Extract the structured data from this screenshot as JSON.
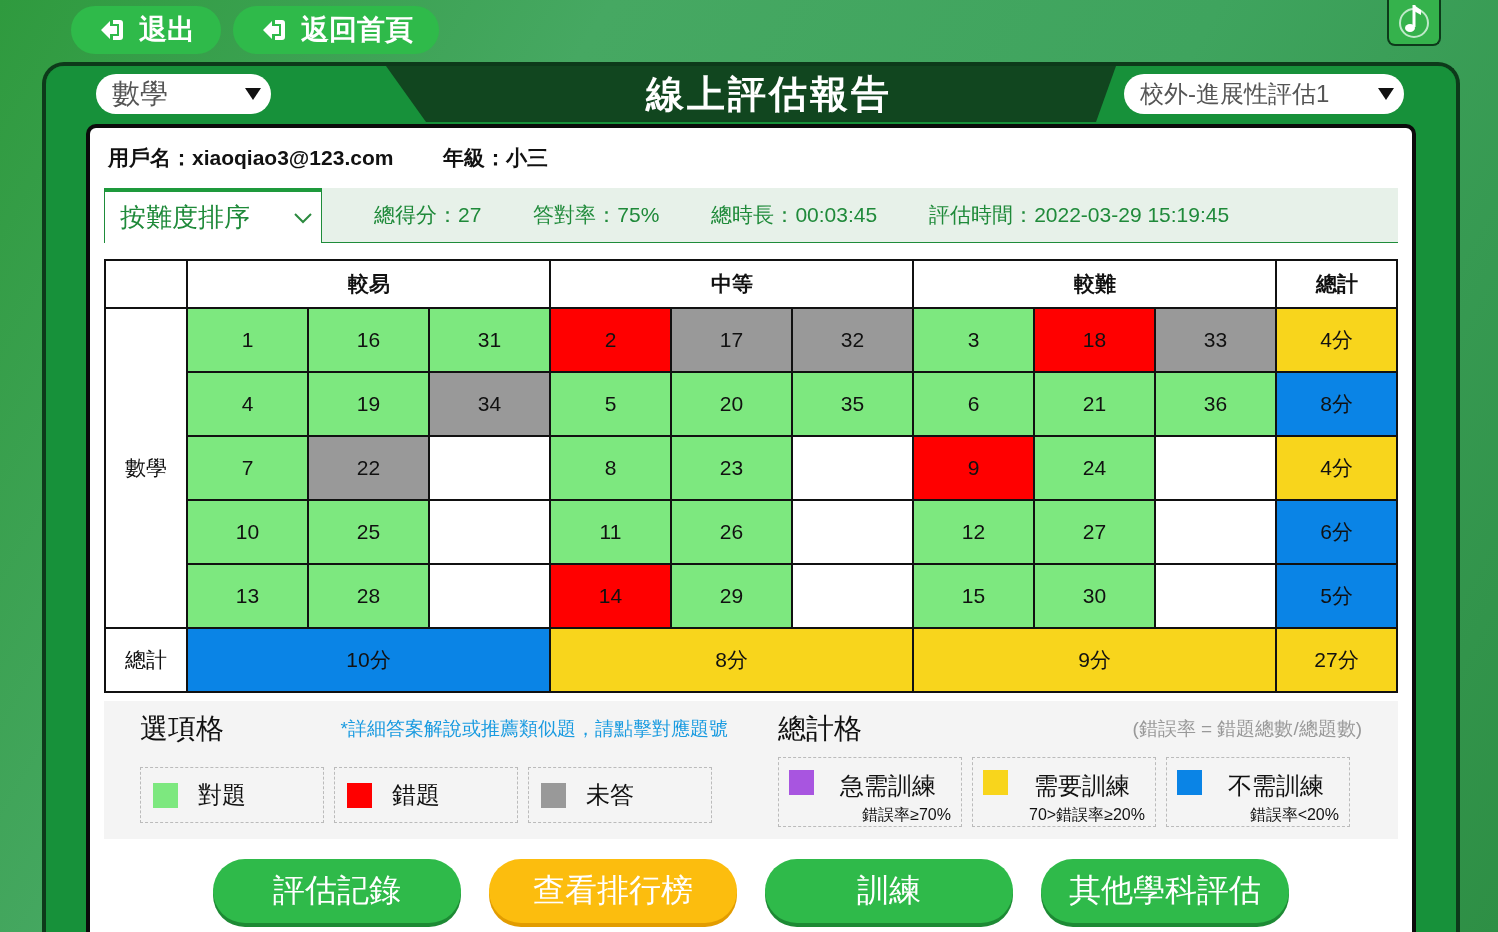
{
  "top_buttons": [
    {
      "label": "退出"
    },
    {
      "label": "返回首頁"
    }
  ],
  "header": {
    "subject_select": {
      "value": "數學"
    },
    "title": "線上評估報告",
    "assessment_select": {
      "value": "校外-進展性評估1"
    }
  },
  "user_info": [
    {
      "label": "用戶名：",
      "value": "xiaoqiao3@123.com"
    },
    {
      "label": "年級：",
      "value": "小三"
    }
  ],
  "summary_bar": {
    "sort_select": {
      "value": "按難度排序"
    },
    "stats": [
      "總得分：27",
      "答對率：75%",
      "總時長：00:03:45",
      "評估時間：2022-03-29 15:19:45"
    ]
  },
  "table": {
    "groups": [
      "較易",
      "中等",
      "較難"
    ],
    "total_header": "總計",
    "row_label": "數學",
    "footer_label": "總計",
    "rows": [
      {
        "cells": [
          {
            "q": "1",
            "color": "#7de87f"
          },
          {
            "q": "16",
            "color": "#7de87f"
          },
          {
            "q": "31",
            "color": "#7de87f"
          },
          {
            "q": "2",
            "color": "#ff0000"
          },
          {
            "q": "17",
            "color": "#999999"
          },
          {
            "q": "32",
            "color": "#999999"
          },
          {
            "q": "3",
            "color": "#7de87f"
          },
          {
            "q": "18",
            "color": "#ff0000"
          },
          {
            "q": "33",
            "color": "#999999"
          }
        ],
        "total": {
          "text": "4分",
          "color": "#f8d51c"
        }
      },
      {
        "cells": [
          {
            "q": "4",
            "color": "#7de87f"
          },
          {
            "q": "19",
            "color": "#7de87f"
          },
          {
            "q": "34",
            "color": "#999999"
          },
          {
            "q": "5",
            "color": "#7de87f"
          },
          {
            "q": "20",
            "color": "#7de87f"
          },
          {
            "q": "35",
            "color": "#7de87f"
          },
          {
            "q": "6",
            "color": "#7de87f"
          },
          {
            "q": "21",
            "color": "#7de87f"
          },
          {
            "q": "36",
            "color": "#7de87f"
          }
        ],
        "total": {
          "text": "8分",
          "color": "#0a84e6"
        }
      },
      {
        "cells": [
          {
            "q": "7",
            "color": "#7de87f"
          },
          {
            "q": "22",
            "color": "#999999"
          },
          null,
          {
            "q": "8",
            "color": "#7de87f"
          },
          {
            "q": "23",
            "color": "#7de87f"
          },
          null,
          {
            "q": "9",
            "color": "#ff0000"
          },
          {
            "q": "24",
            "color": "#7de87f"
          },
          null
        ],
        "total": {
          "text": "4分",
          "color": "#f8d51c"
        }
      },
      {
        "cells": [
          {
            "q": "10",
            "color": "#7de87f"
          },
          {
            "q": "25",
            "color": "#7de87f"
          },
          null,
          {
            "q": "11",
            "color": "#7de87f"
          },
          {
            "q": "26",
            "color": "#7de87f"
          },
          null,
          {
            "q": "12",
            "color": "#7de87f"
          },
          {
            "q": "27",
            "color": "#7de87f"
          },
          null
        ],
        "total": {
          "text": "6分",
          "color": "#0a84e6"
        }
      },
      {
        "cells": [
          {
            "q": "13",
            "color": "#7de87f"
          },
          {
            "q": "28",
            "color": "#7de87f"
          },
          null,
          {
            "q": "14",
            "color": "#ff0000"
          },
          {
            "q": "29",
            "color": "#7de87f"
          },
          null,
          {
            "q": "15",
            "color": "#7de87f"
          },
          {
            "q": "30",
            "color": "#7de87f"
          },
          null
        ],
        "total": {
          "text": "5分",
          "color": "#0a84e6"
        }
      }
    ],
    "group_totals": [
      {
        "text": "10分",
        "color": "#0a84e6"
      },
      {
        "text": "8分",
        "color": "#f8d51c"
      },
      {
        "text": "9分",
        "color": "#f8d51c"
      }
    ],
    "grand_total": {
      "text": "27分",
      "color": "#f8d51c"
    }
  },
  "legend": {
    "options": {
      "title": "選項格",
      "note": "*詳細答案解說或推薦類似題，請點擊對應題號",
      "items": [
        {
          "label": "對題",
          "color": "#7de87f"
        },
        {
          "label": "錯題",
          "color": "#ff0000"
        },
        {
          "label": "未答",
          "color": "#999999"
        }
      ]
    },
    "totals": {
      "title": "總計格",
      "note": "(錯誤率 = 錯題總數/總題數)",
      "items": [
        {
          "label": "急需訓練",
          "rule": "錯誤率≥70%",
          "color": "#a855e0"
        },
        {
          "label": "需要訓練",
          "rule": "70>錯誤率≥20%",
          "color": "#f8d51c"
        },
        {
          "label": "不需訓練",
          "rule": "錯誤率<20%",
          "color": "#0a84e6"
        }
      ]
    }
  },
  "bottom_buttons": [
    {
      "label": "評估記錄",
      "kind": "normal"
    },
    {
      "label": "查看排行榜",
      "kind": "highlight"
    },
    {
      "label": "訓練",
      "kind": "normal"
    },
    {
      "label": "其他學科評估",
      "kind": "normal"
    }
  ]
}
